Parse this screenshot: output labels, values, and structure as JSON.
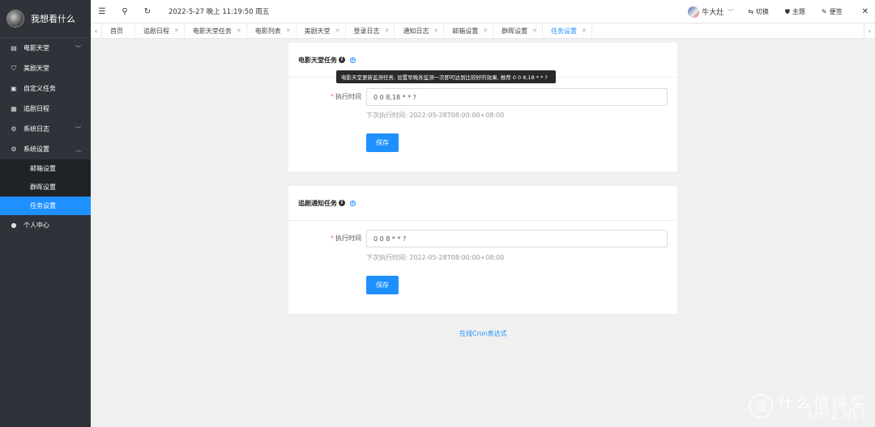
{
  "app": {
    "title": "我想看什么"
  },
  "sidebar": {
    "items": [
      {
        "label": "电影天堂",
        "icon": "document-icon",
        "chevron": "﹀"
      },
      {
        "label": "美剧天堂",
        "icon": "shield-icon"
      },
      {
        "label": "自定义任务",
        "icon": "clipboard-icon"
      },
      {
        "label": "追剧日程",
        "icon": "calendar-icon"
      },
      {
        "label": "系统日志",
        "icon": "gear-icon",
        "chevron": "﹀"
      },
      {
        "label": "系统设置",
        "icon": "gear-icon",
        "chevron": "︿"
      }
    ],
    "subitems": [
      {
        "label": "邮箱设置"
      },
      {
        "label": "群晖设置"
      },
      {
        "label": "任务设置"
      }
    ],
    "profile": {
      "label": "个人中心",
      "icon": "user-icon"
    }
  },
  "topbar": {
    "datetime": "2022-5-27 晚上 11:19:50 周五",
    "user": "牛大灶",
    "switch_label": "切换",
    "theme_label": "主题",
    "note_label": "便签"
  },
  "tabs": [
    {
      "label": "首页"
    },
    {
      "label": "追剧日程"
    },
    {
      "label": "电影天堂任务"
    },
    {
      "label": "电影列表"
    },
    {
      "label": "美剧天堂"
    },
    {
      "label": "登录日志"
    },
    {
      "label": "通知日志"
    },
    {
      "label": "邮箱设置"
    },
    {
      "label": "群晖设置"
    },
    {
      "label": "任务设置"
    }
  ],
  "tasks": [
    {
      "title": "电影天堂任务",
      "tooltip": "电影天堂更新监测任务, 设置早晚各监测一次即可达到比较好的效果, 推荐 0 0 8,18 * * ?",
      "field_label": "执行时间",
      "value": "0 0 8,18 * * ?",
      "next_run": "下次执行时间: 2022-05-28T08:00:00+08:00",
      "save_label": "保存"
    },
    {
      "title": "追剧通知任务",
      "field_label": "执行时间",
      "value": "0 0 8 * * ?",
      "next_run": "下次执行时间: 2022-05-28T08:00:00+08:00",
      "save_label": "保存"
    }
  ],
  "cron_link": "在线Cron表达式",
  "watermark": {
    "text": "什么值得买",
    "logo": "值",
    "site": "SMYZ.NET"
  }
}
